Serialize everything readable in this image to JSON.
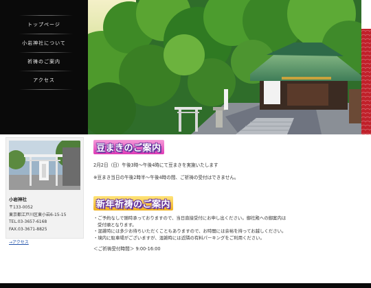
{
  "nav": {
    "items": [
      {
        "label": "トップページ"
      },
      {
        "label": "小岩神社について"
      },
      {
        "label": "祈祷のご案内"
      },
      {
        "label": "アクセス"
      }
    ]
  },
  "sidebar": {
    "name": "小岩神社",
    "postal": "〒133-0052",
    "address": "東京都江戸川区東小岩6-15-15",
    "tel": "TEL.03-3657-6168",
    "fax": "FAX.03-3671-8825",
    "access_link": "→アクセス"
  },
  "section1": {
    "title": "豆まきのご案内",
    "line1": "2月2日（日）午後3時〜午後4時にて豆まきを実施いたします",
    "note": "※豆まき当日の午後2時半〜午後4時の間、ご祈祷の受付はできません。"
  },
  "section2": {
    "title": "新年祈祷のご案内",
    "bullets": [
      "・ご予約なしで随時承っておりますので、当日直接受付にお申し出ください。御社殿への御案内は",
      "受付順となります。",
      "・混雑時には多少お待ちいただくこともありますので、お時間には余裕を持ってお越しください。",
      "・境内に駐車場がございますが、混雑時には近隣の有料パーキングをご利用ください。"
    ],
    "hours": "＜ご祈祷受付時間＞ 9:00-16:00"
  },
  "colors": {
    "nav_bg": "#0a0a0a",
    "heading_pink": "#e03cb6",
    "heading_gold": "#f0b020",
    "heading_outline": "#6b3aa0",
    "pattern_red": "#c0202a",
    "link_blue": "#1d4fa8"
  }
}
